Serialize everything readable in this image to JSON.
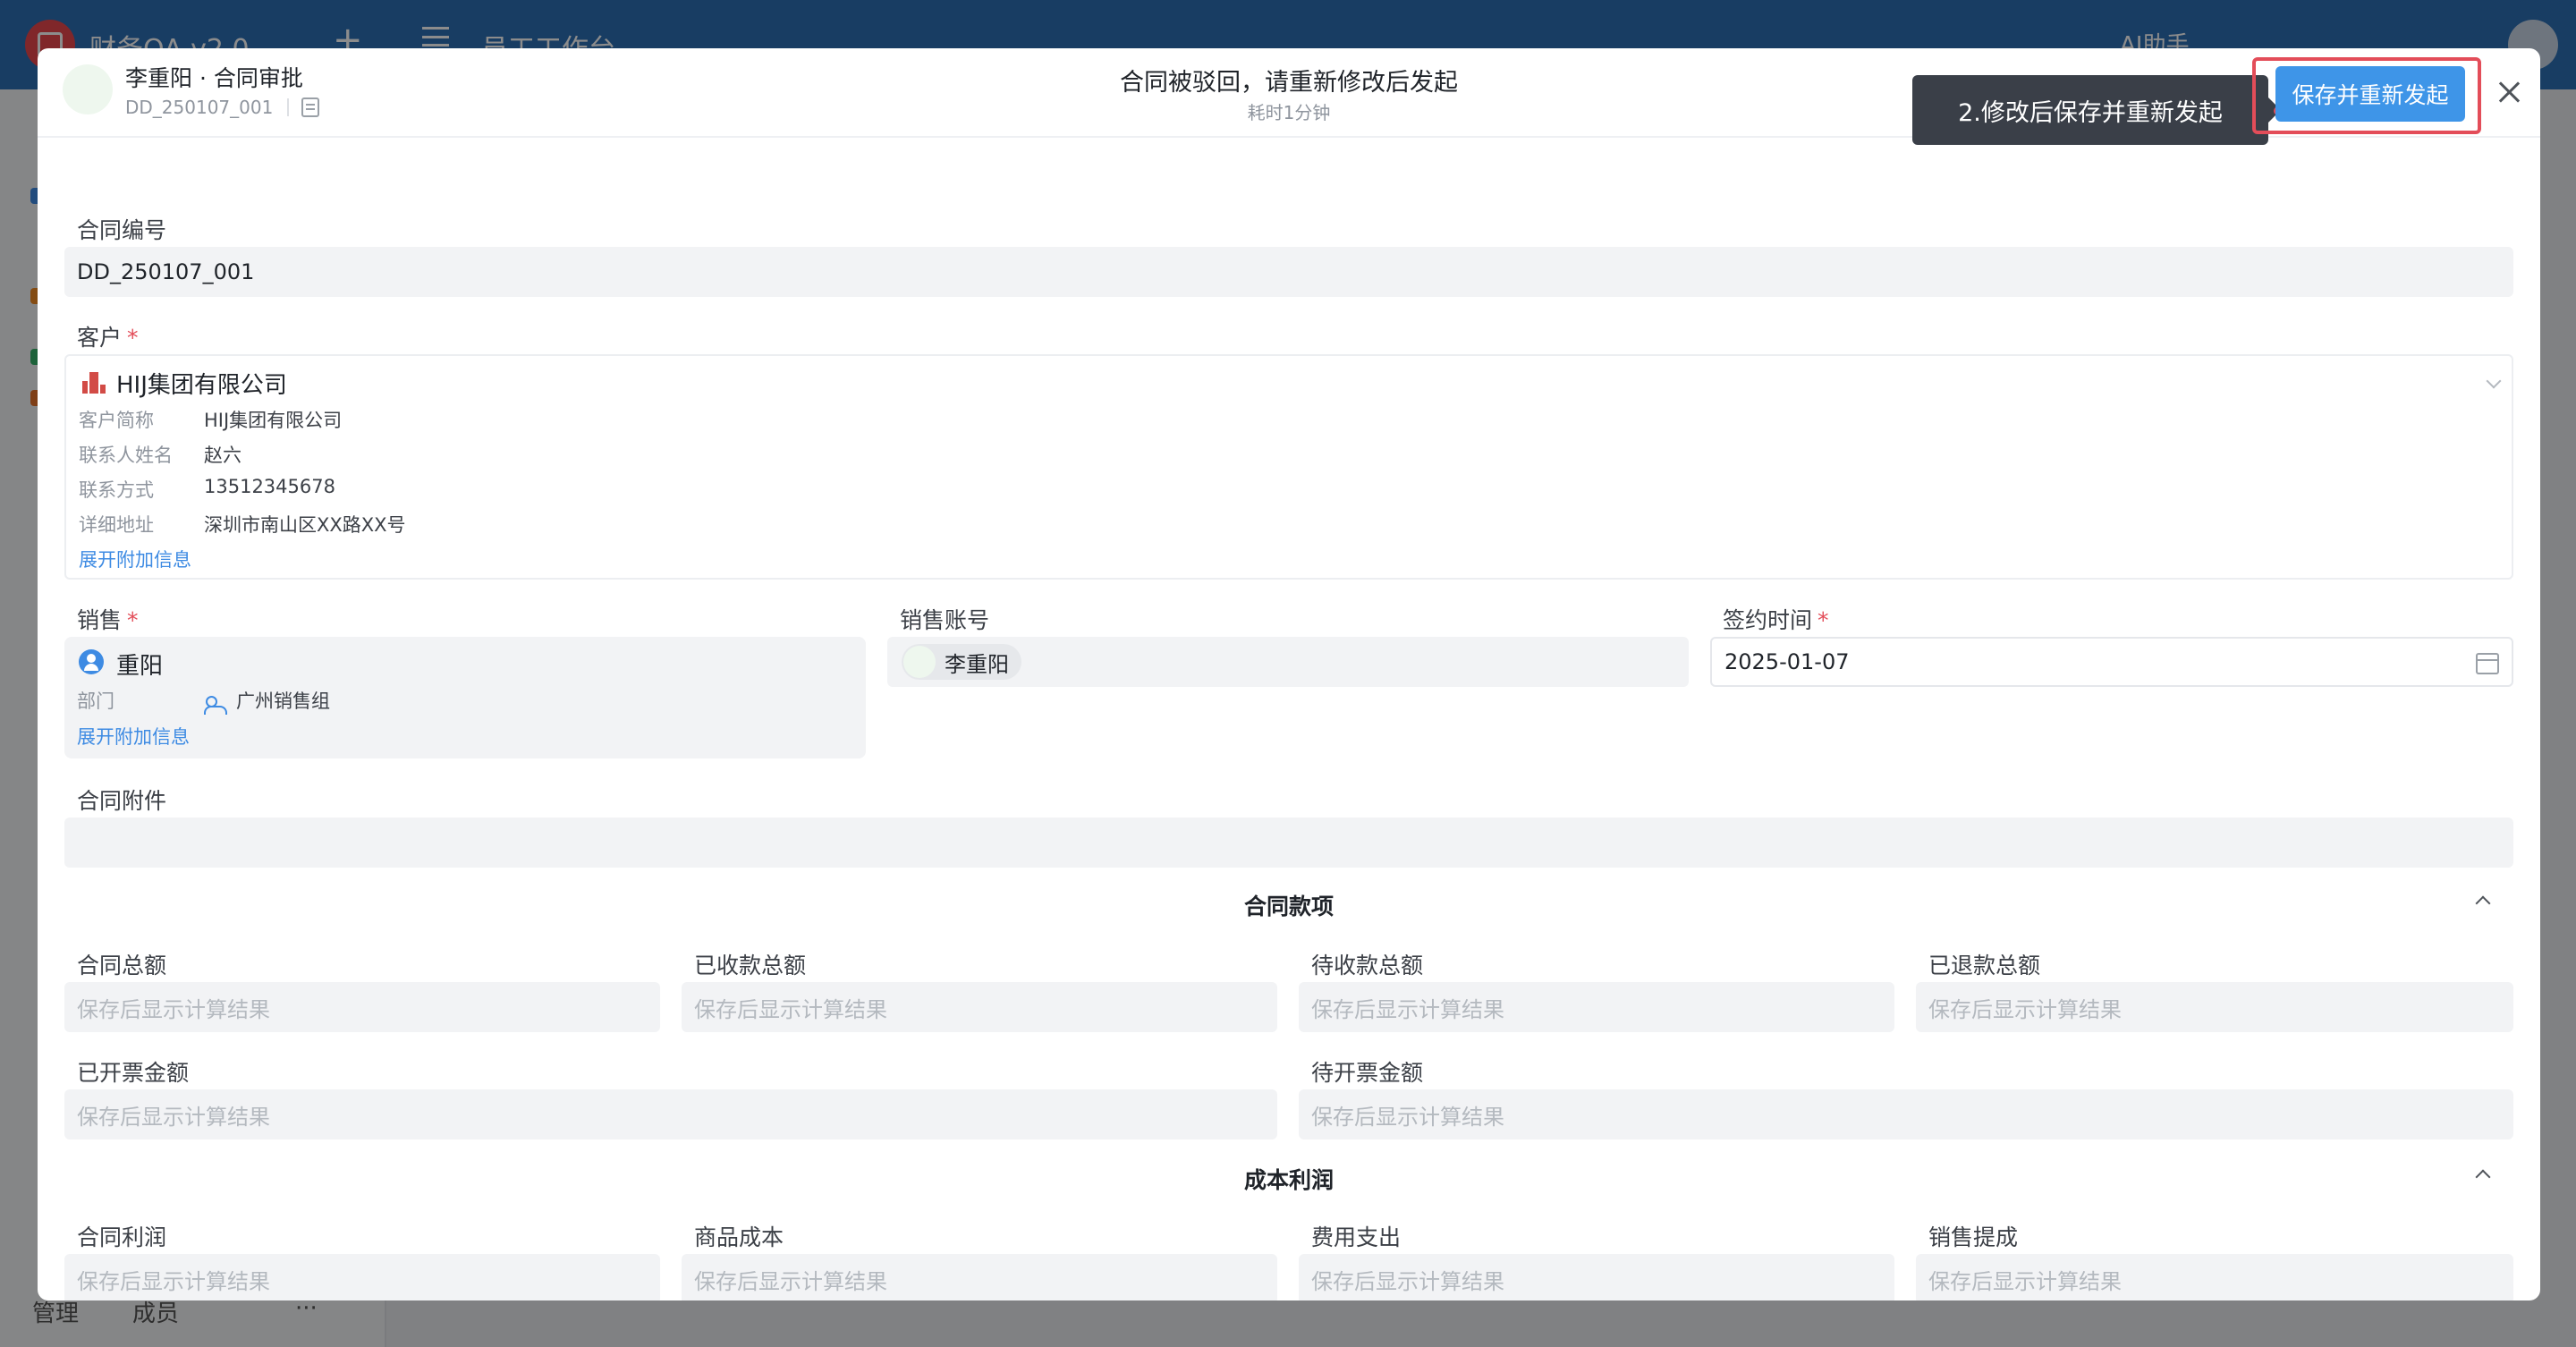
{
  "app": {
    "title": "财务OA v2.0",
    "workspace": "员工工作台 ⌄",
    "ai_label": "AI助手",
    "footer": {
      "manage": "管理",
      "members": "成员",
      "more": "···"
    }
  },
  "header": {
    "title": "李重阳 · 合同审批",
    "subtitle": "DD_250107_001",
    "status_title": "合同被驳回，请重新修改后发起",
    "status_sub": "耗时1分钟",
    "tooltip": "2.修改后保存并重新发起",
    "save_label": "保存并重新发起",
    "accent": "#3e95e8",
    "highlight": "#e34d59"
  },
  "form": {
    "contract_no": {
      "label": "合同编号",
      "value": "DD_250107_001"
    },
    "customer": {
      "label": "客户",
      "required": "*",
      "name": "HIJ集团有限公司",
      "rows": [
        {
          "key": "客户简称",
          "value": "HIJ集团有限公司"
        },
        {
          "key": "联系人姓名",
          "value": "赵六"
        },
        {
          "key": "联系方式",
          "value": "13512345678"
        },
        {
          "key": "详细地址",
          "value": "深圳市南山区XX路XX号"
        }
      ],
      "expand": "展开附加信息"
    },
    "sales": {
      "label": "销售",
      "required": "*",
      "name": "重阳",
      "dept_key": "部门",
      "dept_value": "广州销售组",
      "expand": "展开附加信息"
    },
    "sales_account": {
      "label": "销售账号",
      "value": "李重阳"
    },
    "sign_date": {
      "label": "签约时间",
      "required": "*",
      "value": "2025-01-07"
    },
    "attachment": {
      "label": "合同附件"
    }
  },
  "sections": {
    "payment": {
      "title": "合同款项",
      "fields": [
        {
          "label": "合同总额",
          "placeholder": "保存后显示计算结果"
        },
        {
          "label": "已收款总额",
          "placeholder": "保存后显示计算结果"
        },
        {
          "label": "待收款总额",
          "placeholder": "保存后显示计算结果"
        },
        {
          "label": "已退款总额",
          "placeholder": "保存后显示计算结果"
        },
        {
          "label": "已开票金额",
          "placeholder": "保存后显示计算结果"
        },
        {
          "label": "待开票金额",
          "placeholder": "保存后显示计算结果"
        }
      ]
    },
    "profit": {
      "title": "成本利润",
      "fields": [
        {
          "label": "合同利润",
          "placeholder": "保存后显示计算结果"
        },
        {
          "label": "商品成本",
          "placeholder": "保存后显示计算结果"
        },
        {
          "label": "费用支出",
          "placeholder": "保存后显示计算结果"
        },
        {
          "label": "销售提成",
          "placeholder": "保存后显示计算结果"
        }
      ]
    }
  }
}
